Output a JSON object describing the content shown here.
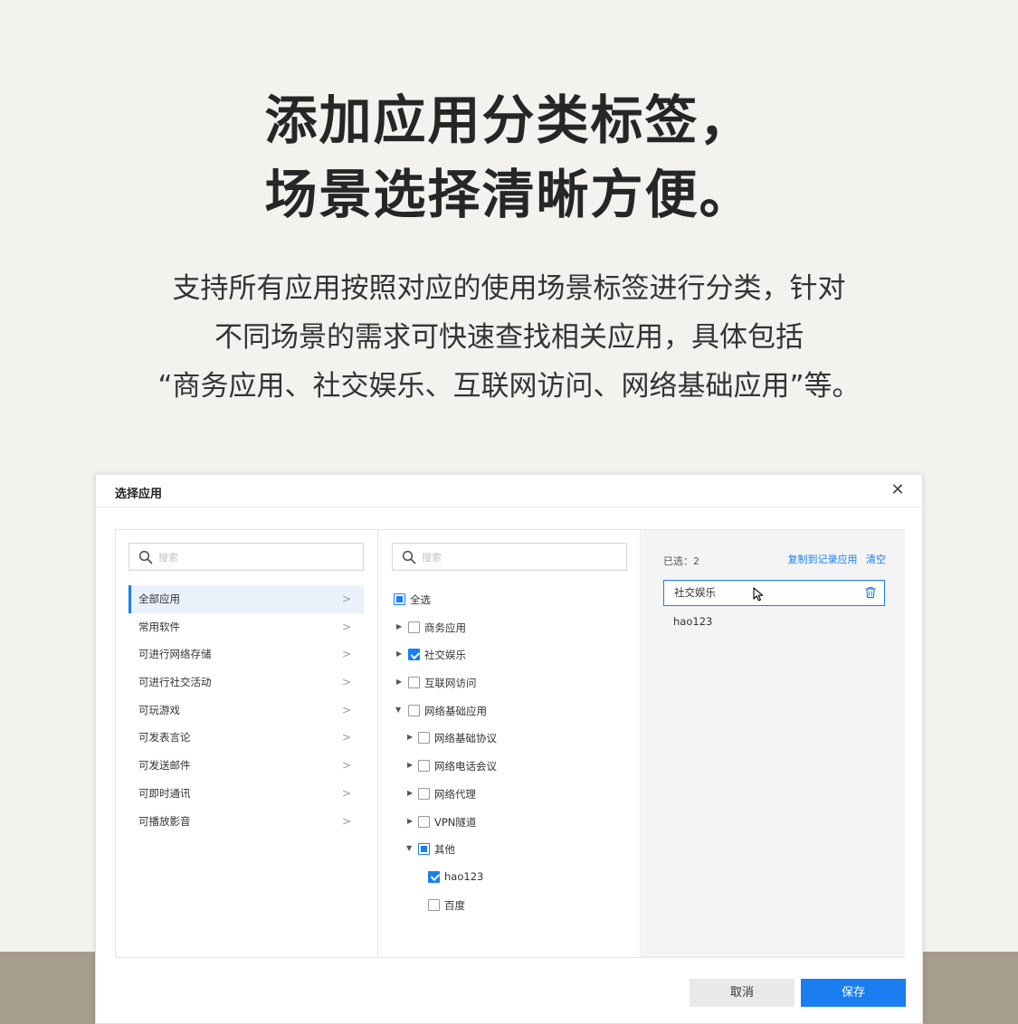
{
  "headline": {
    "line1": "添加应用分类标签，",
    "line2": "场景选择清晰方便。"
  },
  "description": {
    "line1": "支持所有应用按照对应的使用场景标签进行分类，针对",
    "line2": "不同场景的需求可快速查找相关应用，具体包括",
    "line3": "“商务应用、社交娱乐、互联网访问、网络基础应用”等。"
  },
  "dialog": {
    "title": "选择应用",
    "close_glyph": "✕",
    "left": {
      "search_placeholder": "搜索",
      "categories": [
        {
          "label": "全部应用",
          "active": true
        },
        {
          "label": "常用软件"
        },
        {
          "label": "可进行网络存储"
        },
        {
          "label": "可进行社交活动"
        },
        {
          "label": "可玩游戏"
        },
        {
          "label": "可发表言论"
        },
        {
          "label": "可发送邮件"
        },
        {
          "label": "可即时通讯"
        },
        {
          "label": "可播放影音"
        }
      ],
      "chevron": ">"
    },
    "middle": {
      "search_placeholder": "搜索",
      "select_all": "全选",
      "tree": [
        {
          "label": "商务应用",
          "state": "unchecked"
        },
        {
          "label": "社交娱乐",
          "state": "checked"
        },
        {
          "label": "互联网访问",
          "state": "unchecked"
        },
        {
          "label": "网络基础应用",
          "state": "unchecked",
          "expanded": true
        },
        {
          "label": "网络基础协议",
          "state": "unchecked"
        },
        {
          "label": "网络电话会议",
          "state": "unchecked"
        },
        {
          "label": "网络代理",
          "state": "unchecked"
        },
        {
          "label": "VPN隧道",
          "state": "unchecked"
        },
        {
          "label": "其他",
          "state": "partial",
          "expanded": true
        },
        {
          "label": "hao123",
          "state": "checked"
        },
        {
          "label": "百度",
          "state": "unchecked"
        }
      ]
    },
    "right": {
      "selected_count": "已选：2",
      "copy_link": "复制到记录应用",
      "clear_link": "清空",
      "selected_items": [
        "社交娱乐",
        "hao123"
      ]
    },
    "buttons": {
      "cancel": "取消",
      "save": "保存"
    }
  },
  "colors": {
    "accent": "#1a7ef0",
    "background": "#f3f2ef",
    "band": "#a69d8d"
  }
}
